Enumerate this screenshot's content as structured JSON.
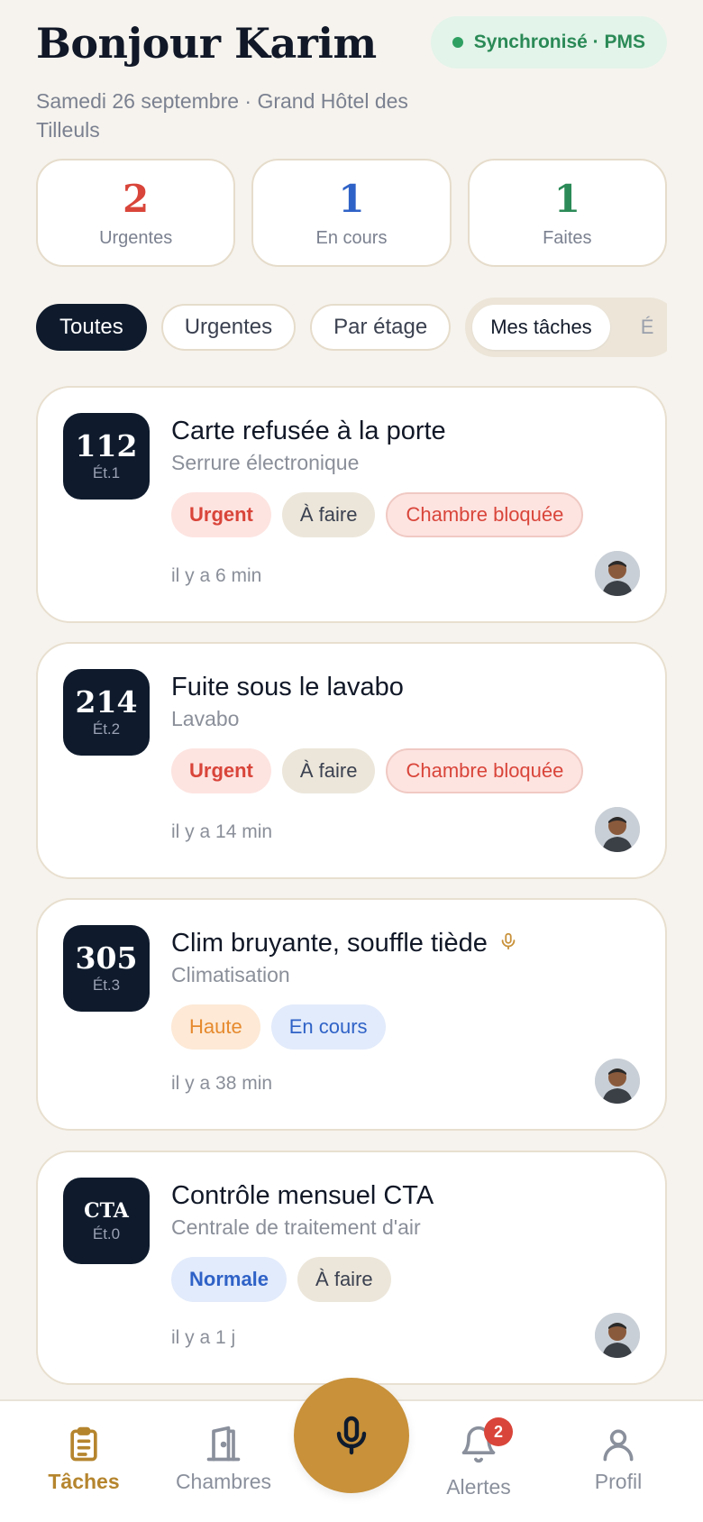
{
  "header": {
    "greeting": "Bonjour Karim",
    "subtitle": "Samedi 26 septembre · Grand Hôtel des Tilleuls",
    "sync_label": "Synchronisé · PMS"
  },
  "stats": [
    {
      "value": "2",
      "label": "Urgentes"
    },
    {
      "value": "1",
      "label": "En cours"
    },
    {
      "value": "1",
      "label": "Faites"
    }
  ],
  "filters": {
    "chips": [
      "Toutes",
      "Urgentes",
      "Par étage"
    ],
    "segment": [
      "Mes tâches",
      "É"
    ]
  },
  "tasks": [
    {
      "room": "112",
      "floor": "Ét.1",
      "title": "Carte refusée à la porte",
      "subtitle": "Serrure électronique",
      "tags": [
        "Urgent",
        "À faire",
        "Chambre bloquée"
      ],
      "time": "il y a 6 min"
    },
    {
      "room": "214",
      "floor": "Ét.2",
      "title": "Fuite sous le lavabo",
      "subtitle": "Lavabo",
      "tags": [
        "Urgent",
        "À faire",
        "Chambre bloquée"
      ],
      "time": "il y a 14 min"
    },
    {
      "room": "305",
      "floor": "Ét.3",
      "title": "Clim bruyante, souffle tiède",
      "subtitle": "Climatisation",
      "tags": [
        "Haute",
        "En cours"
      ],
      "time": "il y a 38 min",
      "voice_note_icon": "microphone-icon"
    },
    {
      "room": "CTA",
      "floor": "Ét.0",
      "title": "Contrôle mensuel CTA",
      "subtitle": "Centrale de traitement d'air",
      "tags": [
        "Normale",
        "À faire"
      ],
      "time": "il y a 1 j"
    }
  ],
  "tabbar": {
    "tasks": "Tâches",
    "rooms": "Chambres",
    "alerts": "Alertes",
    "alerts_badge": "2",
    "profile": "Profil"
  },
  "colors": {
    "accent": "#c8913a",
    "navy": "#0f1b2d",
    "urgent": "#d9453a",
    "in_progress": "#2f62c7",
    "done": "#2b8a57",
    "background": "#f6f3ee"
  }
}
